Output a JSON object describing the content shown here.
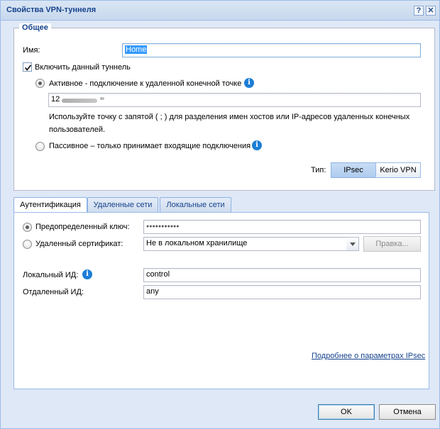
{
  "window": {
    "title": "Свойства VPN-туннеля",
    "help_glyph": "?",
    "close_glyph": "✕"
  },
  "general": {
    "legend": "Общее",
    "name_label": "Имя:",
    "name_value": "Home",
    "enable_label": "Включить данный туннель",
    "enable_checked": true,
    "active_label": "Активное - подключение к удаленной конечной точке",
    "active_selected": true,
    "endpoint_value": "12",
    "hint_line1": "Используйте точку с запятой ( ; ) для разделения имен хостов или IP-адресов удаленных конечных",
    "hint_line2": "пользователей.",
    "passive_label": "Пассивное – только принимает входящие подключения",
    "type_label": "Тип:",
    "type_options": [
      "IPsec",
      "Kerio VPN"
    ],
    "type_selected": "IPsec"
  },
  "tabs": [
    "Аутентификация",
    "Удаленные сети",
    "Локальные сети"
  ],
  "auth": {
    "psk_label": "Предопределенный ключ:",
    "psk_value": "●●●●●●●●●●●",
    "cert_label": "Удаленный сертификат:",
    "cert_value": "Не в локальном хранилище",
    "edit_button": "Правка...",
    "local_id_label": "Локальный ИД:",
    "local_id_value": "control",
    "remote_id_label": "Отдаленный ИД:",
    "remote_id_value": "any",
    "more_link": "Подробнее о параметрах IPsec"
  },
  "footer": {
    "ok_label": "OK",
    "cancel_label": "Отмена"
  },
  "info_glyph": "i",
  "colors": {
    "title_text": "#15428b",
    "frame": "#dfe8f6",
    "selection": "#3399ff",
    "info": "#1c7ed6"
  }
}
